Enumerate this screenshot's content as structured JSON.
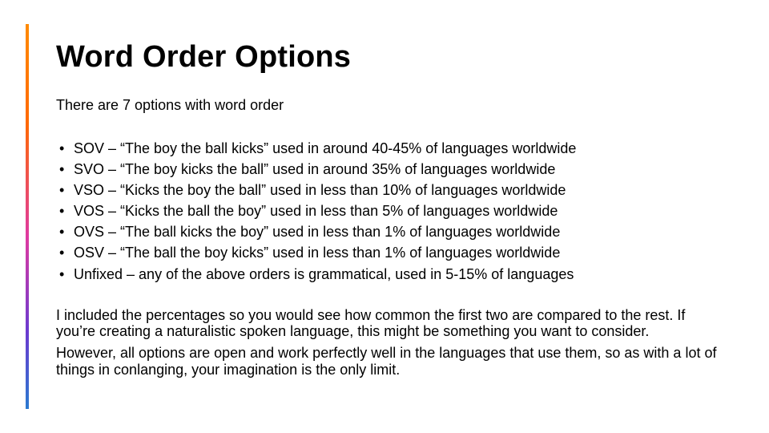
{
  "title": "Word Order Options",
  "intro": "There are 7 options with word order",
  "items": [
    "SOV – “The boy the ball kicks” used in around 40-45% of languages worldwide",
    "SVO – “The boy kicks the ball” used in around 35% of languages worldwide",
    "VSO – “Kicks the boy the ball” used in less than 10% of languages worldwide",
    "VOS – “Kicks the ball the boy” used in less than 5% of languages worldwide",
    "OVS – “The ball kicks the boy” used in less than 1% of languages worldwide",
    "OSV – “The ball the boy kicks” used in less than 1% of languages worldwide",
    "Unfixed – any of the above orders is grammatical, used in 5-15% of languages"
  ],
  "p1": "I included the percentages so you would see how common the first two are compared to the rest.  If you’re creating a naturalistic spoken language, this might be something you want to consider.",
  "p2": "However, all options are open and work perfectly well in the languages that use them, so as with a lot of things in conlanging, your imagination is the only limit."
}
